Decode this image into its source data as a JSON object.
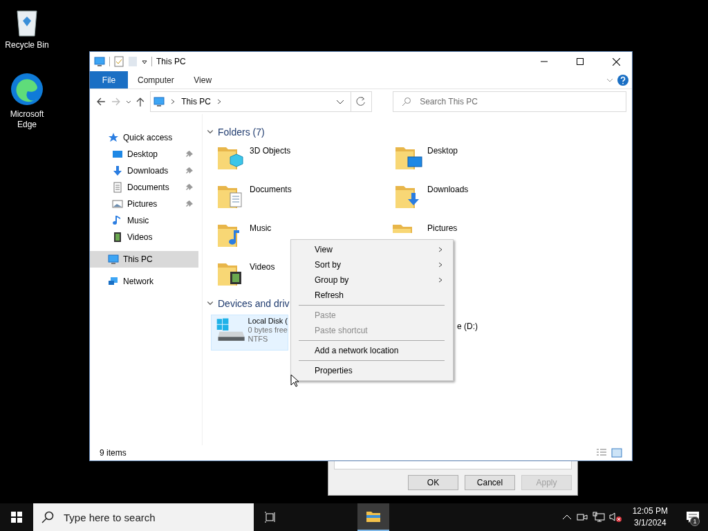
{
  "desktop_icons": [
    {
      "label": "Recycle Bin",
      "kind": "recycle"
    },
    {
      "label": "Microsoft Edge",
      "kind": "edge"
    }
  ],
  "dialog": {
    "buttons": [
      {
        "label": "OK",
        "disabled": false
      },
      {
        "label": "Cancel",
        "disabled": false
      },
      {
        "label": "Apply",
        "disabled": true
      }
    ]
  },
  "window": {
    "title": "This PC",
    "ribbon_tabs": [
      {
        "label": "File",
        "selected": true
      },
      {
        "label": "Computer",
        "selected": false
      },
      {
        "label": "View",
        "selected": false
      }
    ],
    "address": {
      "crumbs": [
        "This PC"
      ]
    },
    "search": {
      "placeholder": "Search This PC"
    },
    "nav": [
      {
        "label": "Quick access",
        "kind": "star",
        "selected": false,
        "children": [
          {
            "label": "Desktop",
            "kind": "desktop",
            "pinned": true,
            "selected": false
          },
          {
            "label": "Downloads",
            "kind": "downloads",
            "pinned": true,
            "selected": false
          },
          {
            "label": "Documents",
            "kind": "documents",
            "pinned": true,
            "selected": false
          },
          {
            "label": "Pictures",
            "kind": "pictures",
            "pinned": true,
            "selected": false
          },
          {
            "label": "Music",
            "kind": "music",
            "pinned": false,
            "selected": false
          },
          {
            "label": "Videos",
            "kind": "videos",
            "pinned": false,
            "selected": false
          }
        ]
      },
      {
        "label": "This PC",
        "kind": "pc",
        "selected": true
      },
      {
        "label": "Network",
        "kind": "network",
        "selected": false
      }
    ],
    "folders_header": {
      "label": "Folders (7)",
      "expanded": true
    },
    "folders": [
      {
        "label": "3D Objects",
        "kind": "objects"
      },
      {
        "label": "Desktop",
        "kind": "desktop"
      },
      {
        "label": "Documents",
        "kind": "documents"
      },
      {
        "label": "Downloads",
        "kind": "downloads"
      },
      {
        "label": "Music",
        "kind": "music"
      },
      {
        "label": "Pictures",
        "kind": "pictures"
      },
      {
        "label": "Videos",
        "kind": "videos"
      }
    ],
    "devices_header": {
      "label": "Devices and driv",
      "expanded": true
    },
    "drives": [
      {
        "name": "Local Disk (",
        "free": "0 bytes free",
        "filesystem": "NTFS",
        "kind": "system"
      },
      {
        "name": "e (D:)",
        "kind": "hidden"
      }
    ],
    "status_bar": {
      "text": "9 items"
    }
  },
  "context_menu": [
    {
      "kind": "item",
      "label": "View",
      "submenu": true,
      "disabled": false
    },
    {
      "kind": "item",
      "label": "Sort by",
      "submenu": true,
      "disabled": false
    },
    {
      "kind": "item",
      "label": "Group by",
      "submenu": true,
      "disabled": false
    },
    {
      "kind": "item",
      "label": "Refresh",
      "submenu": false,
      "disabled": false
    },
    {
      "kind": "separator"
    },
    {
      "kind": "item",
      "label": "Paste",
      "submenu": false,
      "disabled": true
    },
    {
      "kind": "item",
      "label": "Paste shortcut",
      "submenu": false,
      "disabled": true
    },
    {
      "kind": "separator"
    },
    {
      "kind": "item",
      "label": "Add a network location",
      "submenu": false,
      "disabled": false
    },
    {
      "kind": "separator"
    },
    {
      "kind": "item",
      "label": "Properties",
      "submenu": false,
      "disabled": false
    }
  ],
  "taskbar": {
    "search": {
      "placeholder": "Type here to search"
    },
    "time": "12:05 PM",
    "date": "3/1/2024",
    "notification_count": "1"
  }
}
